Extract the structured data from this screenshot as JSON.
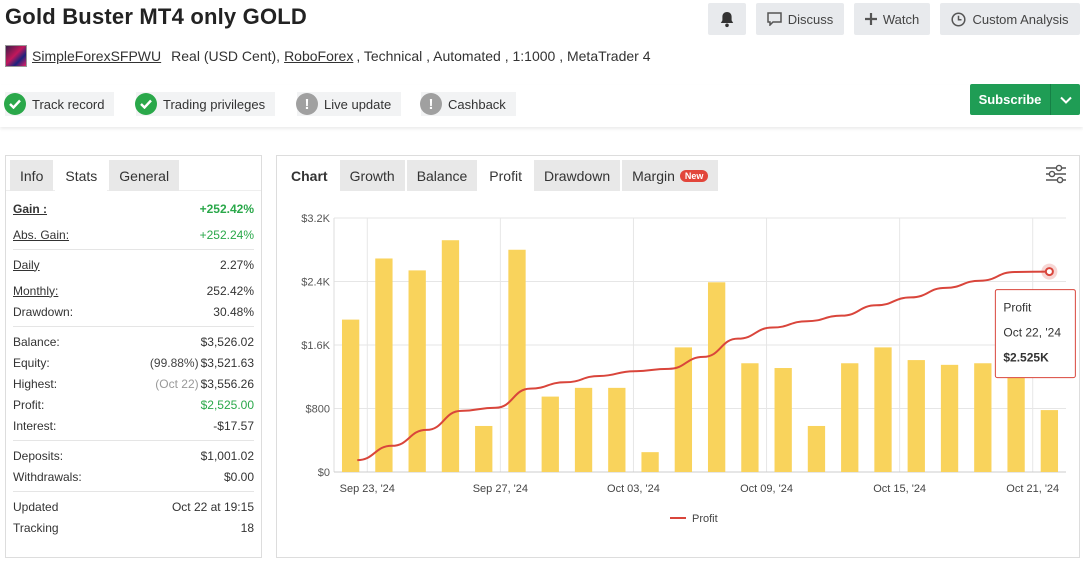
{
  "header": {
    "title": "Gold Buster MT4 only GOLD",
    "buttons": {
      "alerts_icon": "bell-icon",
      "discuss": "Discuss",
      "watch": "Watch",
      "custom_analysis": "Custom Analysis"
    }
  },
  "subtitle": {
    "user": "SimpleForexSFPWU",
    "account_type": "Real (USD Cent),",
    "broker": "RoboForex",
    "details": ", Technical , Automated , 1:1000 , MetaTrader 4"
  },
  "badges": [
    {
      "label": "Track record",
      "status": "ok"
    },
    {
      "label": "Trading privileges",
      "status": "ok"
    },
    {
      "label": "Live update",
      "status": "warn"
    },
    {
      "label": "Cashback",
      "status": "warn"
    }
  ],
  "subscribe": {
    "label": "Subscribe"
  },
  "left_tabs": [
    "Info",
    "Stats",
    "General"
  ],
  "stats": {
    "gain": {
      "label": "Gain :",
      "value": "+252.42%"
    },
    "abs_gain": {
      "label": "Abs. Gain:",
      "value": "+252.24%"
    },
    "daily": {
      "label": "Daily",
      "value": "2.27%"
    },
    "monthly": {
      "label": "Monthly:",
      "value": "252.42%"
    },
    "drawdown": {
      "label": "Drawdown:",
      "value": "30.48%"
    },
    "balance": {
      "label": "Balance:",
      "value": "$3,526.02"
    },
    "equity": {
      "label": "Equity:",
      "note": "(99.88%)",
      "value": "$3,521.63"
    },
    "highest": {
      "label": "Highest:",
      "note": "(Oct 22)",
      "value": "$3,556.26"
    },
    "profit": {
      "label": "Profit:",
      "value": "$2,525.00"
    },
    "interest": {
      "label": "Interest:",
      "value": "-$17.57"
    },
    "deposits": {
      "label": "Deposits:",
      "value": "$1,001.02"
    },
    "withdrawals": {
      "label": "Withdrawals:",
      "value": "$0.00"
    },
    "updated": {
      "label": "Updated",
      "value": "Oct 22 at 19:15"
    },
    "tracking": {
      "label": "Tracking",
      "value": "18"
    }
  },
  "chart_tabs": {
    "chart": "Chart",
    "growth": "Growth",
    "balance": "Balance",
    "profit": "Profit",
    "drawdown": "Drawdown",
    "margin": "Margin",
    "margin_badge": "New"
  },
  "colors": {
    "bar": "#f9d35c",
    "line": "#d9453b",
    "green": "#2aa84a",
    "subscribe": "#1f9d55"
  },
  "tooltip": {
    "title": "Profit",
    "date": "Oct 22, '24",
    "value": "$2.525K"
  },
  "chart_data": {
    "type": "bar+line",
    "ylabels": [
      "$3.2K",
      "$2.4K",
      "$1.6K",
      "$800",
      "$0"
    ],
    "ylim": [
      0,
      3200
    ],
    "xlabels": [
      "Sep 23, '24",
      "Sep 27, '24",
      "Oct 03, '24",
      "Oct 09, '24",
      "Oct 15, '24",
      "Oct 21, '24"
    ],
    "legend": "Profit",
    "bars": [
      1920,
      2690,
      2540,
      2920,
      580,
      2800,
      950,
      1060,
      1060,
      250,
      1570,
      2390,
      1370,
      1310,
      580,
      1370,
      1570,
      1410,
      1350,
      1370,
      1310,
      780
    ],
    "line": [
      150,
      330,
      530,
      770,
      810,
      1050,
      1130,
      1210,
      1270,
      1300,
      1450,
      1680,
      1820,
      1900,
      1970,
      2100,
      2200,
      2320,
      2410,
      2520,
      2525
    ],
    "line_start_index": 0.2
  }
}
